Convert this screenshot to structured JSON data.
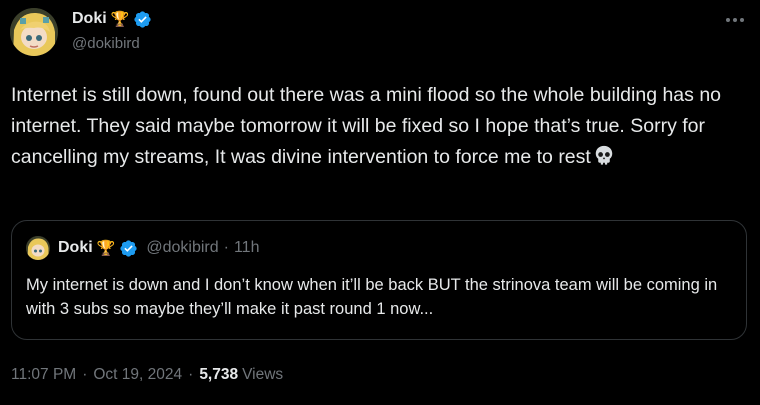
{
  "author": {
    "name": "Doki",
    "handle": "@dokibird",
    "badge_emoji": "🏆",
    "verified_color": "#1d9bf0"
  },
  "tweet": {
    "text": "Internet is still down, found out there was a mini flood so the whole building has no internet. They said maybe tomorrow it will be fixed so I hope that’s true. Sorry for cancelling my streams, It was divine intervention to force me to rest",
    "trailing_icon": "skull-emoji"
  },
  "quote": {
    "name": "Doki",
    "handle": "@dokibird",
    "separator": "·",
    "time": "11h",
    "text": "My internet is down and I don’t know when it’ll be back BUT the strinova team will be coming in with 3 subs so maybe they’ll make it past round 1 now..."
  },
  "meta": {
    "time": "11:07 PM",
    "separator": "·",
    "date": "Oct 19, 2024",
    "views_count": "5,738",
    "views_label": "Views"
  },
  "colors": {
    "background": "#000000",
    "text": "#e7e9ea",
    "muted": "#71767b",
    "border": "#2f3336",
    "verified": "#1d9bf0"
  },
  "icons": [
    "more-icon",
    "verified-icon",
    "trophy-icon",
    "skull-icon"
  ]
}
